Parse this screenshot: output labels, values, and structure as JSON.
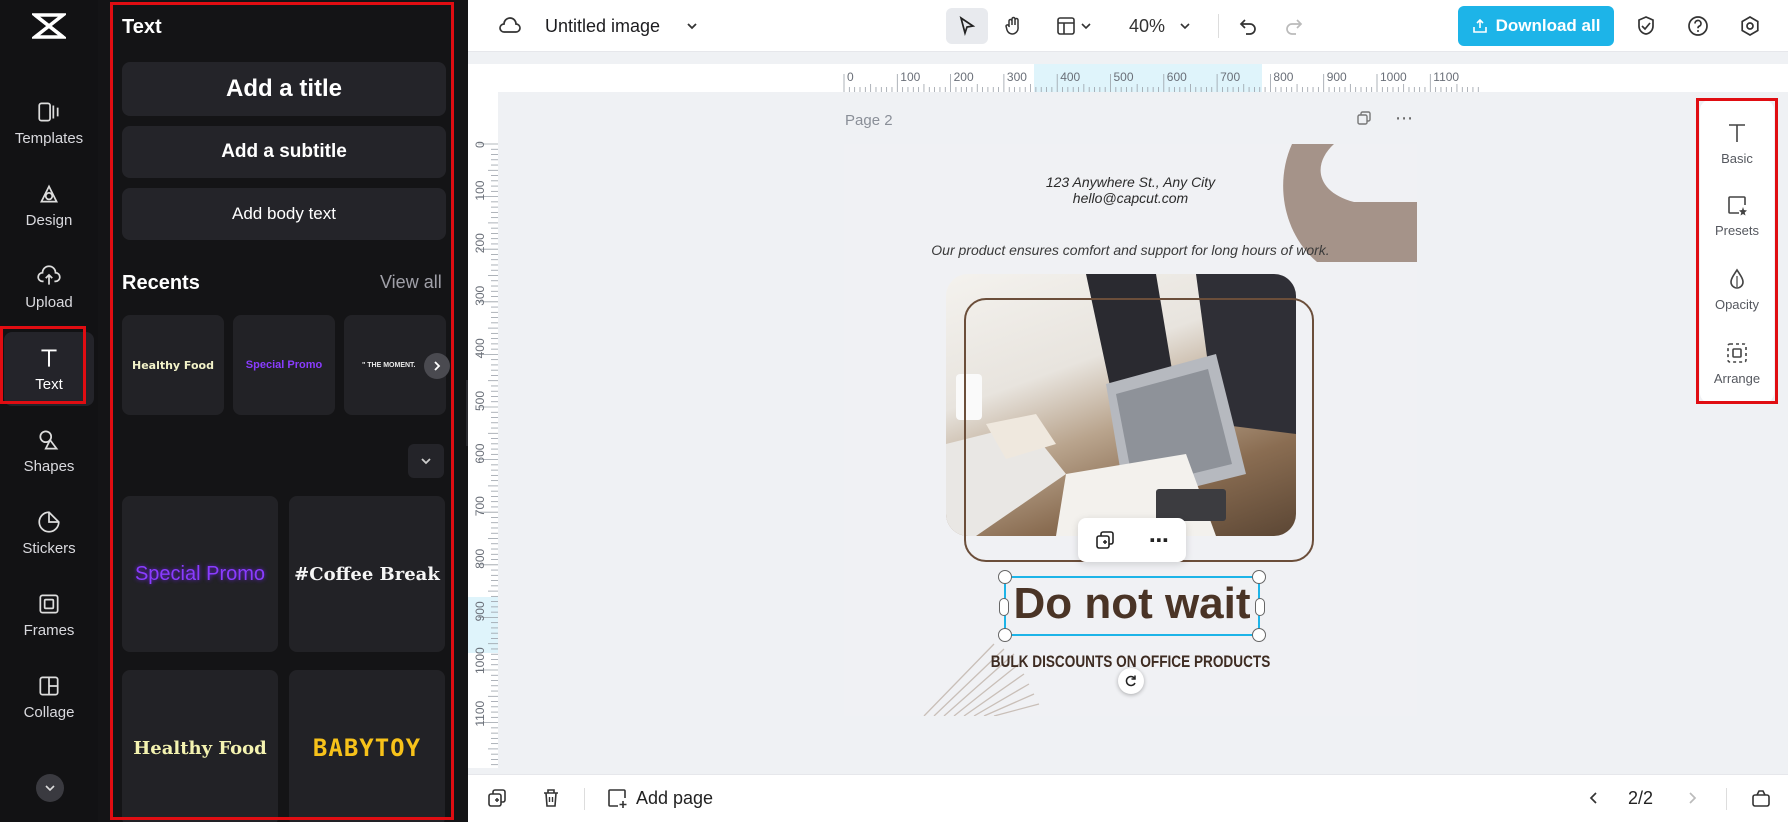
{
  "nav": {
    "logo": "⌘",
    "items": [
      {
        "label": "Templates",
        "icon": "templates-icon"
      },
      {
        "label": "Design",
        "icon": "design-icon"
      },
      {
        "label": "Upload",
        "icon": "upload-icon"
      },
      {
        "label": "Text",
        "icon": "text-icon"
      },
      {
        "label": "Shapes",
        "icon": "shapes-icon"
      },
      {
        "label": "Stickers",
        "icon": "stickers-icon"
      },
      {
        "label": "Frames",
        "icon": "frames-icon"
      },
      {
        "label": "Collage",
        "icon": "collage-icon"
      }
    ]
  },
  "panel": {
    "title": "Text",
    "add_title": "Add a title",
    "add_subtitle": "Add a subtitle",
    "add_body": "Add body text",
    "recents_title": "Recents",
    "view_all": "View all",
    "recents": [
      {
        "text": "Healthy Food",
        "color": "#f2f2c8"
      },
      {
        "text": "Special Promo",
        "color": "#8a3cff"
      },
      {
        "text": "\" THE MOMENT.",
        "color": "#eaeaea"
      }
    ],
    "templates": [
      {
        "text": "Special Promo",
        "color": "#8a3cff"
      },
      {
        "text": "#Coffee Break",
        "color": "#f5f5f5"
      },
      {
        "text": "Healthy Food",
        "color": "#f4f3b0"
      },
      {
        "text": "BABYTOY",
        "color": "#f7c21a"
      }
    ]
  },
  "topbar": {
    "title": "Untitled image",
    "zoom": "40%",
    "download_label": "Download all"
  },
  "ruler": {
    "top_ticks": [
      "0",
      "100",
      "200",
      "300",
      "400",
      "500",
      "600",
      "700",
      "800",
      "900",
      "1000",
      "1100"
    ],
    "left_ticks": [
      "0",
      "100",
      "200",
      "300",
      "400",
      "500",
      "600",
      "700",
      "800",
      "900",
      "1000",
      "1100"
    ]
  },
  "page": {
    "label": "Page 2",
    "address": "123 Anywhere St., Any City",
    "email": "hello@capcut.com",
    "tagline": "Our product ensures comfort and support for long hours of work.",
    "headline": "Do not wait",
    "subheadline": "BULK DISCOUNTS ON OFFICE PRODUCTS"
  },
  "right_tools": [
    {
      "label": "Basic",
      "icon": "basic-text-icon"
    },
    {
      "label": "Presets",
      "icon": "presets-icon"
    },
    {
      "label": "Opacity",
      "icon": "opacity-icon"
    },
    {
      "label": "Arrange",
      "icon": "arrange-icon"
    }
  ],
  "bottombar": {
    "add_page": "Add page",
    "page_counter": "2/2"
  },
  "colors": {
    "accent": "#1db4e8",
    "highlight": "#e00d12",
    "headline": "#4a3426"
  }
}
